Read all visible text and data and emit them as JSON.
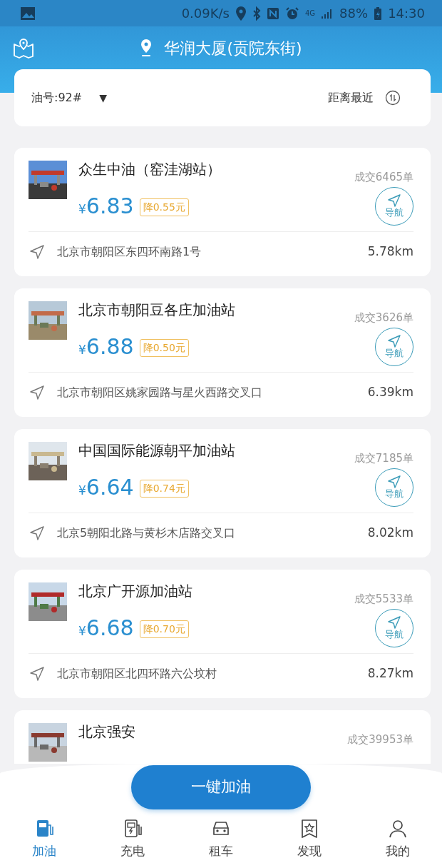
{
  "status_bar": {
    "speed": "0.09K/s",
    "network": "4G",
    "battery": "88%",
    "time": "14:30"
  },
  "header": {
    "location": "华润大厦(贡院东街)"
  },
  "filter": {
    "fuel": "油号:92#",
    "dropdown": "▼",
    "sort": "距离最近"
  },
  "stations": [
    {
      "kind": "picture",
      "name": "众生中油（窑洼湖站）",
      "orders": "成交6465单",
      "price": "6.83",
      "currency": "¥",
      "discount": "降0.55元",
      "nav": "导航",
      "address": "北京市朝阳区东四环南路1号",
      "distance": "5.78km"
    },
    {
      "kind": "picture",
      "name": "北京市朝阳豆各庄加油站",
      "orders": "成交3626单",
      "price": "6.88",
      "currency": "¥",
      "discount": "降0.50元",
      "nav": "导航",
      "address": "北京市朝阳区姚家园路与星火西路交叉口",
      "distance": "6.39km"
    },
    {
      "kind": "picture",
      "name": "中国国际能源朝平加油站",
      "orders": "成交7185单",
      "price": "6.64",
      "currency": "¥",
      "discount": "降0.74元",
      "nav": "导航",
      "address": "北京5朝阳北路与黄杉木店路交叉口",
      "distance": "8.02km"
    },
    {
      "kind": "picture",
      "name": "北京广开源加油站",
      "orders": "成交5533单",
      "price": "6.68",
      "currency": "¥",
      "discount": "降0.70元",
      "nav": "导航",
      "address": "北京市朝阳区北四环路六公坟村",
      "distance": "8.27km"
    },
    {
      "kind": "picture",
      "name": "北京强安",
      "orders": "成交39953单"
    }
  ],
  "action_button": "一键加油",
  "tabs": [
    {
      "label": "加油",
      "kind": "fuel",
      "selected": true
    },
    {
      "label": "充电",
      "kind": "charge",
      "selected": false
    },
    {
      "label": "租车",
      "kind": "car",
      "selected": false
    },
    {
      "label": "发现",
      "kind": "discover",
      "selected": false
    },
    {
      "label": "我的",
      "kind": "user",
      "selected": false
    }
  ]
}
